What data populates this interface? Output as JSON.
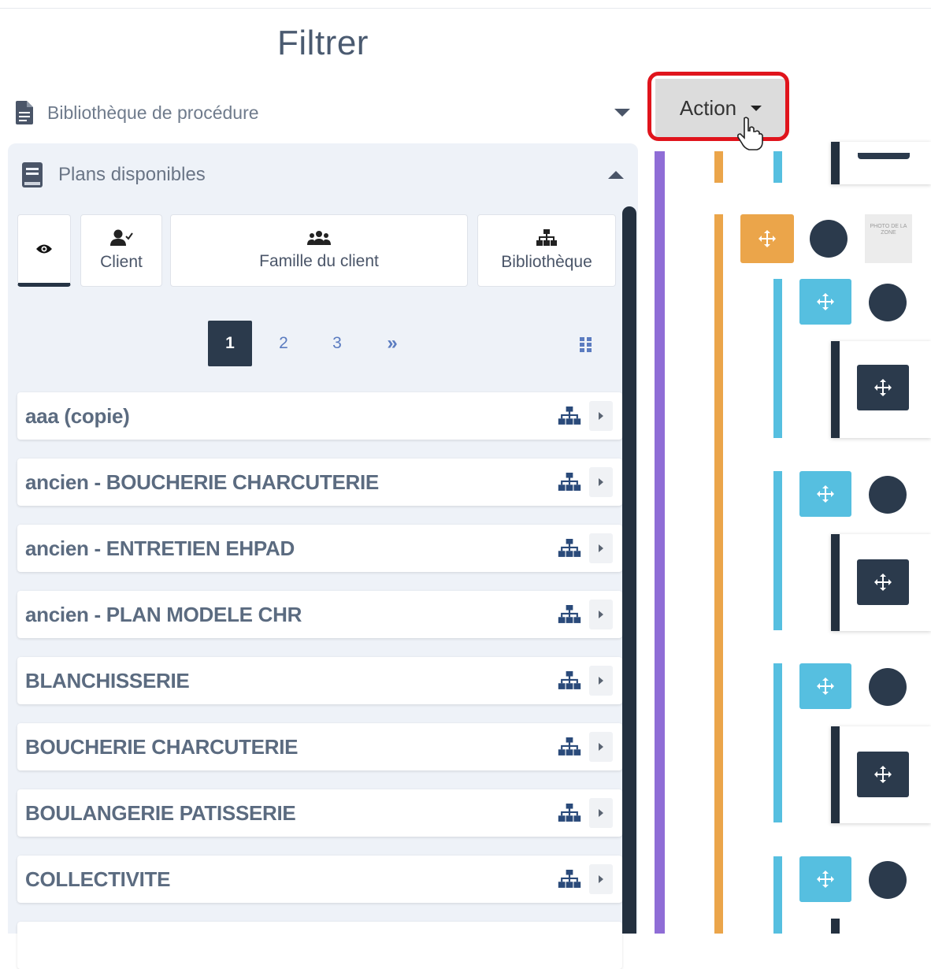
{
  "title": "Filtrer",
  "procedure_select": {
    "label": "Bibliothèque de procédure"
  },
  "panel": {
    "title": "Plans disponibles"
  },
  "tabs": [
    {
      "label": "",
      "icon": "eye-icon",
      "active": true
    },
    {
      "label": "Client",
      "icon": "user-check-icon"
    },
    {
      "label": "Famille du client",
      "icon": "users-icon"
    },
    {
      "label": "Bibliothèque",
      "icon": "sitemap-icon"
    }
  ],
  "pagination": {
    "pages": [
      "1",
      "2",
      "3"
    ],
    "current": "1",
    "next": "»"
  },
  "plans": [
    "aaa (copie)",
    "ancien - BOUCHERIE CHARCUTERIE",
    "ancien - ENTRETIEN EHPAD",
    "ancien - PLAN MODELE CHR",
    "BLANCHISSERIE",
    "BOUCHERIE CHARCUTERIE",
    "BOULANGERIE PATISSERIE",
    "COLLECTIVITE"
  ],
  "action_button": {
    "label": "Action"
  },
  "photo_placeholder": "PHOTO DE LA ZONE",
  "colors": {
    "dark": "#2b3a4c",
    "orange": "#eba54a",
    "cyan": "#56bfe0",
    "purple": "#8f6dd6",
    "highlight": "#e0141c"
  }
}
